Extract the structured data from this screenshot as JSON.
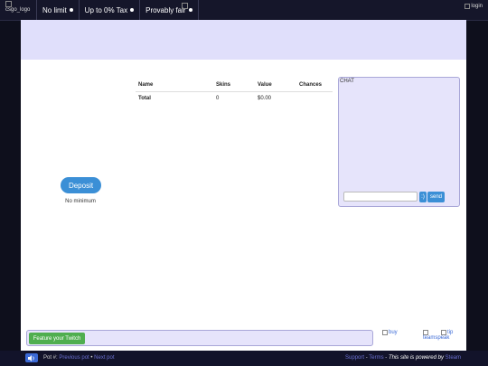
{
  "header": {
    "logo_alt": "csgo_logo",
    "nav": [
      {
        "label": "No limit"
      },
      {
        "label": "Up to 0% Tax"
      },
      {
        "label": "Provably fair"
      }
    ],
    "login_alt": "login"
  },
  "deposit": {
    "button_label": "Deposit",
    "note": "No minimum"
  },
  "pot_table": {
    "headers": [
      "Name",
      "Skins",
      "Value",
      "Chances"
    ],
    "total_row": {
      "name": "Total",
      "skins": "0",
      "value": "$0.00",
      "chances": ""
    }
  },
  "chat": {
    "title": "CHAT",
    "input_value": "",
    "emoji_label": ":)",
    "send_label": "send"
  },
  "bottom": {
    "twitch_label": "Feature your Twitch",
    "buy_alt": "buy",
    "teamspeak_alt": "teamspeak",
    "tip_alt": "tip"
  },
  "footer": {
    "pot_label": "Pot #:",
    "previous_label": "Previous pot",
    "separator": "•",
    "next_label": "Next pot",
    "support_label": "Support",
    "dash": "-",
    "terms_label": "Terms",
    "powered_text": "This site is powered by",
    "steam_label": "Steam"
  },
  "colors": {
    "accent_blue": "#3b8fd6",
    "twitch_green": "#4fae4f",
    "panel_lavender": "#e6e4fb",
    "banner_lavender": "#e0dffb",
    "page_bg": "#0e0f1c"
  }
}
